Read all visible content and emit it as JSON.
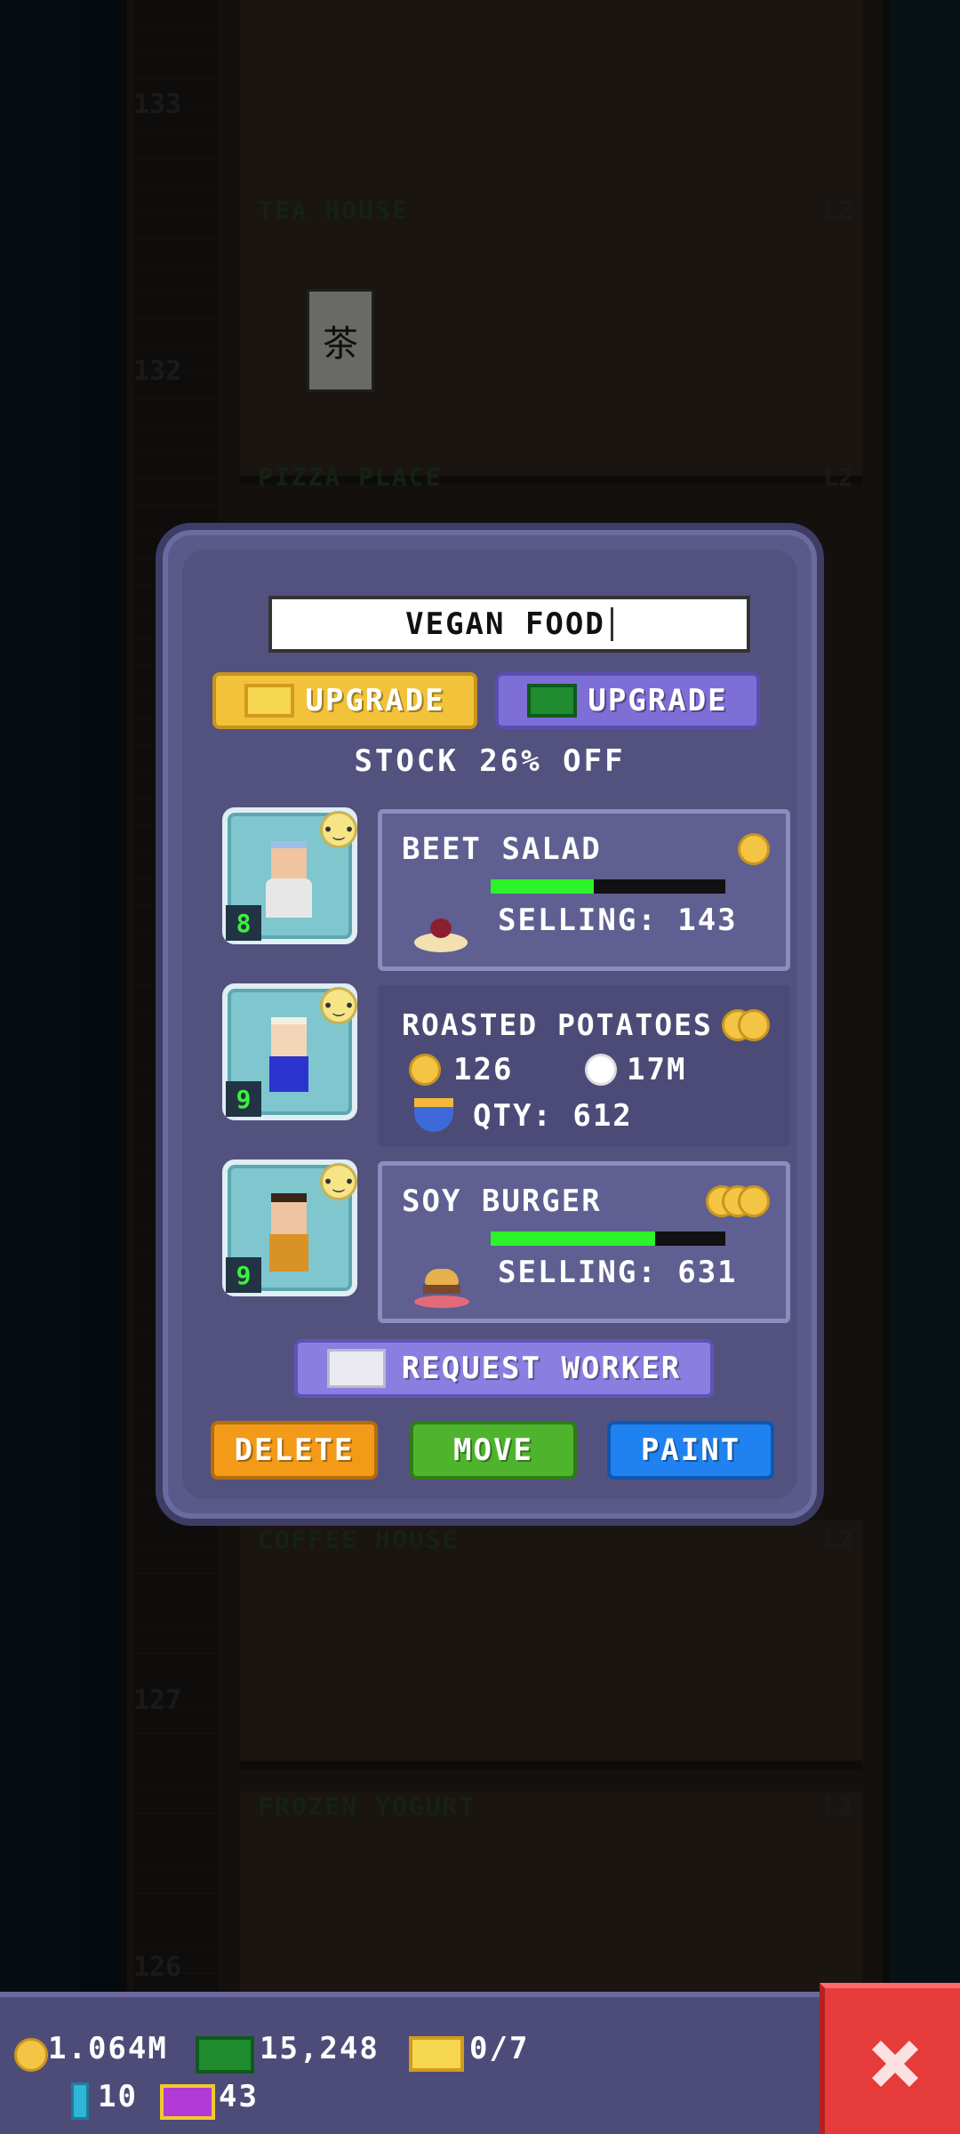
{
  "background": {
    "floors": [
      {
        "number": "133",
        "name": "",
        "level": ""
      },
      {
        "number": "",
        "name": "TEA HOUSE",
        "level": "L2"
      },
      {
        "number": "132",
        "name": "",
        "level": ""
      },
      {
        "number": "",
        "name": "PIZZA PLACE",
        "level": "L2"
      },
      {
        "number": "",
        "name": "COFFEE HOUSE",
        "level": "L2"
      },
      {
        "number": "127",
        "name": "",
        "level": ""
      },
      {
        "number": "",
        "name": "FROZEN YOGURT",
        "level": "L2"
      },
      {
        "number": "126",
        "name": "",
        "level": ""
      }
    ],
    "sign_text": "茶"
  },
  "dialog": {
    "name_value": "VEGAN FOOD",
    "upgrade_coin_label": "UPGRADE",
    "upgrade_bux_label": "UPGRADE",
    "stock_discount": "STOCK 26% OFF",
    "workers": [
      {
        "level": "8",
        "mood": "neutral"
      },
      {
        "level": "9",
        "mood": "neutral"
      },
      {
        "level": "9",
        "mood": "neutral"
      }
    ],
    "products": [
      {
        "name": "BEET SALAD",
        "coins": 1,
        "selling_label": "SELLING: 143",
        "progress": 0.44
      },
      {
        "name": "ROASTED POTATOES",
        "coins": 2,
        "cost": "126",
        "time": "17M",
        "qty_label": "QTY: 612"
      },
      {
        "name": "SOY BURGER",
        "coins": 3,
        "selling_label": "SELLING: 631",
        "progress": 0.7
      }
    ],
    "request_worker_label": "REQUEST WORKER",
    "delete_label": "DELETE",
    "move_label": "MOVE",
    "paint_label": "PAINT"
  },
  "resources": {
    "coins": "1.064M",
    "bux": "15,248",
    "tickets": "0/7",
    "keys": "10",
    "vip": "43"
  },
  "colors": {
    "dialog_bg": "#53527f",
    "progress": "#2ef22a",
    "coin": "#f4c544",
    "close": "#e53b3b"
  }
}
